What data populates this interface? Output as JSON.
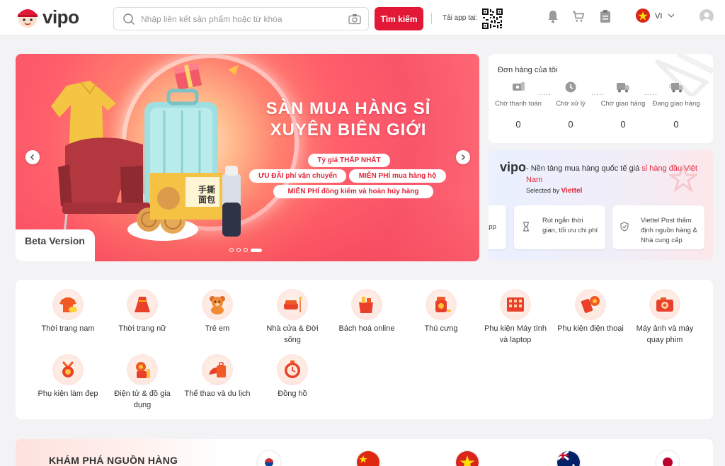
{
  "header": {
    "brand": "vipo",
    "search_placeholder": "Nhập liên kết sản phẩm hoặc từ khóa",
    "search_button": "Tìm kiếm",
    "app_label": "Tải app tại:",
    "language": "VI"
  },
  "banner": {
    "title_line1": "SÀN MUA HÀNG SỈ",
    "title_line2": "XUYÊN BIÊN GIỚI",
    "pill1": "Tỷ giá THẤP NHẤT",
    "pill2": "ƯU ĐÃI phí vận chuyển",
    "pill3": "MIỄN PHÍ mua hàng hộ",
    "pill4": "MIỄN PHÍ đồng kiểm và hoàn hủy hàng",
    "beta_label": "Beta Version",
    "slide_count": 4,
    "active_slide": 4
  },
  "orders": {
    "title": "Đơn hàng của tôi",
    "statuses": [
      {
        "label": "Chờ thanh toán",
        "count": "0",
        "icon": "payment-wait-icon"
      },
      {
        "label": "Chờ xử lý",
        "count": "0",
        "icon": "processing-clock-icon"
      },
      {
        "label": "Chờ giao hàng",
        "count": "0",
        "icon": "truck-wait-icon"
      },
      {
        "label": "Đang giao hàng",
        "count": "0",
        "icon": "truck-delivering-icon"
      }
    ]
  },
  "promo": {
    "logo": "vipo",
    "text_prefix": " - Nền tảng mua hàng quốc tế giá ",
    "text_highlight": "sỉ hàng đầu Việt Nam",
    "selected_by": "Selected by",
    "selected_by_brand": "Viettel",
    "features": [
      {
        "text": "app",
        "icon": "app-icon"
      },
      {
        "text": "Rút ngắn thời gian, tối ưu chi phí",
        "icon": "hourglass-icon"
      },
      {
        "text": "Viettel Post thẩm định nguồn hàng & Nhà cung cấp",
        "icon": "shield-check-icon"
      }
    ]
  },
  "categories": [
    {
      "name": "Thời trang nam",
      "icon": "mens-fashion-icon"
    },
    {
      "name": "Thời trang nữ",
      "icon": "womens-fashion-icon"
    },
    {
      "name": "Trẻ em",
      "icon": "teddy-bear-icon"
    },
    {
      "name": "Nhà cửa & Đời sống",
      "icon": "sofa-lamp-icon"
    },
    {
      "name": "Bách hoá online",
      "icon": "grocery-icon"
    },
    {
      "name": "Thú cưng",
      "icon": "pet-food-icon"
    },
    {
      "name": "Phụ kiện Máy tính và laptop",
      "icon": "keyboard-icon"
    },
    {
      "name": "Phụ kiện điện thoại",
      "icon": "phone-accessory-icon"
    },
    {
      "name": "Máy ảnh và máy quay phim",
      "icon": "camera-icon"
    },
    {
      "name": "Phụ kiện làm đẹp",
      "icon": "beauty-accessory-icon"
    },
    {
      "name": "Điện tử & đồ gia dụng",
      "icon": "appliance-icon"
    },
    {
      "name": "Thể thao và du lịch",
      "icon": "sport-travel-icon"
    },
    {
      "name": "Đồng hồ",
      "icon": "clock-icon"
    }
  ],
  "source": {
    "title": "KHÁM PHÁ NGUỒN HÀNG",
    "flags": [
      "south-korea-flag-icon",
      "china-flag-icon",
      "vietnam-flag-icon",
      "australia-flag-icon",
      "japan-flag-icon"
    ]
  },
  "colors": {
    "brand_red": "#e21836",
    "accent_text_red": "#e2263c"
  }
}
